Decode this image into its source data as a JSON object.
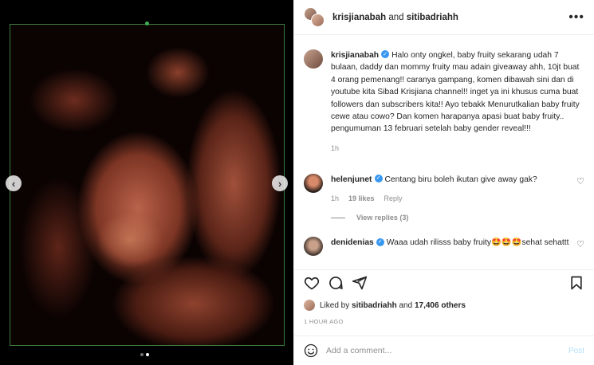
{
  "header": {
    "user1": "krisjianabah",
    "joiner": "and",
    "user2": "sitibadriahh"
  },
  "caption": {
    "username": "krisjianabah",
    "text": "Halo onty ongkel, baby fruity sekarang udah 7 bulaan, daddy dan mommy fruity mau adain giveaway ahh, 10jt buat 4 orang pemenang!! caranya gampang, komen dibawah sini dan di youtube kita Sibad Krisjiana channel!! inget ya ini khusus cuma buat followers dan subscribers kita!! Ayo tebakk Menurutkalian baby fruity cewe atau cowo? Dan komen harapanya apasi buat baby fruity.. pengumuman 13 februari setelah baby gender reveal!!!",
    "time": "1h"
  },
  "comments": [
    {
      "username": "helenjunet",
      "text": "Centang biru boleh ikutan give away gak?",
      "time": "1h",
      "likes": "19 likes",
      "reply": "Reply",
      "view_replies": "View replies (3)"
    },
    {
      "username": "denidenias",
      "text": "Waaa udah rilisss baby fruity🤩🤩🤩sehat sehattt"
    }
  ],
  "liked_by": {
    "prefix": "Liked by",
    "user": "sitibadriahh",
    "joiner": "and",
    "others": "17,406 others"
  },
  "timestamp": "1 HOUR AGO",
  "comment_box": {
    "placeholder": "Add a comment...",
    "post_label": "Post"
  },
  "icons": {
    "more": "more-options-icon",
    "like": "heart-icon",
    "comment": "comment-icon",
    "share": "share-icon",
    "save": "bookmark-icon",
    "emoji": "emoji-icon",
    "prev": "chevron-left-icon",
    "next": "chevron-right-icon"
  },
  "colors": {
    "verified": "#3897f0",
    "post_button": "#b2dffc",
    "muted_text": "#8e8e8e"
  },
  "carousel": {
    "slide_count": 2,
    "active_index": 1
  }
}
